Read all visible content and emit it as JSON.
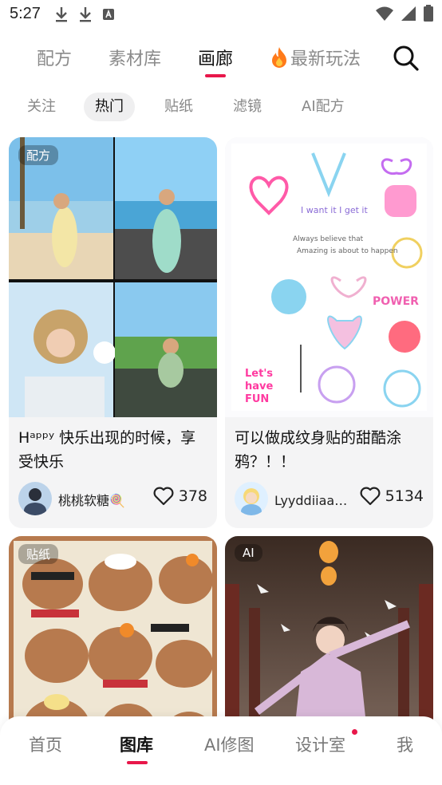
{
  "status": {
    "time": "5:27"
  },
  "top_tabs": [
    {
      "label": "配方"
    },
    {
      "label": "素材库"
    },
    {
      "label": "画廊"
    },
    {
      "label": "最新玩法"
    }
  ],
  "sub_tabs": [
    {
      "label": "关注"
    },
    {
      "label": "热门"
    },
    {
      "label": "贴纸"
    },
    {
      "label": "滤镜"
    },
    {
      "label": "AI配方"
    }
  ],
  "cards": [
    {
      "tag": "配方",
      "title": "Hᵃᵖᵖʸ 快乐出现的时候，享受快乐",
      "author": "桃桃软糖🍭",
      "likes": "378"
    },
    {
      "tag": "",
      "title": "可以做成纹身贴的甜酷涂鸦？！！",
      "author": "Lyyddiiaa莉...",
      "likes": "5134"
    },
    {
      "tag": "贴纸",
      "title": "",
      "author": "",
      "likes": ""
    },
    {
      "tag": "AI",
      "title": "",
      "author": "",
      "likes": ""
    }
  ],
  "bottom_nav": [
    {
      "label": "首页"
    },
    {
      "label": "图库"
    },
    {
      "label": "AI修图"
    },
    {
      "label": "设计室"
    },
    {
      "label": "我"
    }
  ],
  "colors": {
    "accent": "#e8174a",
    "chip_bg": "#efeff0",
    "card_bg": "#f4f4f5"
  }
}
